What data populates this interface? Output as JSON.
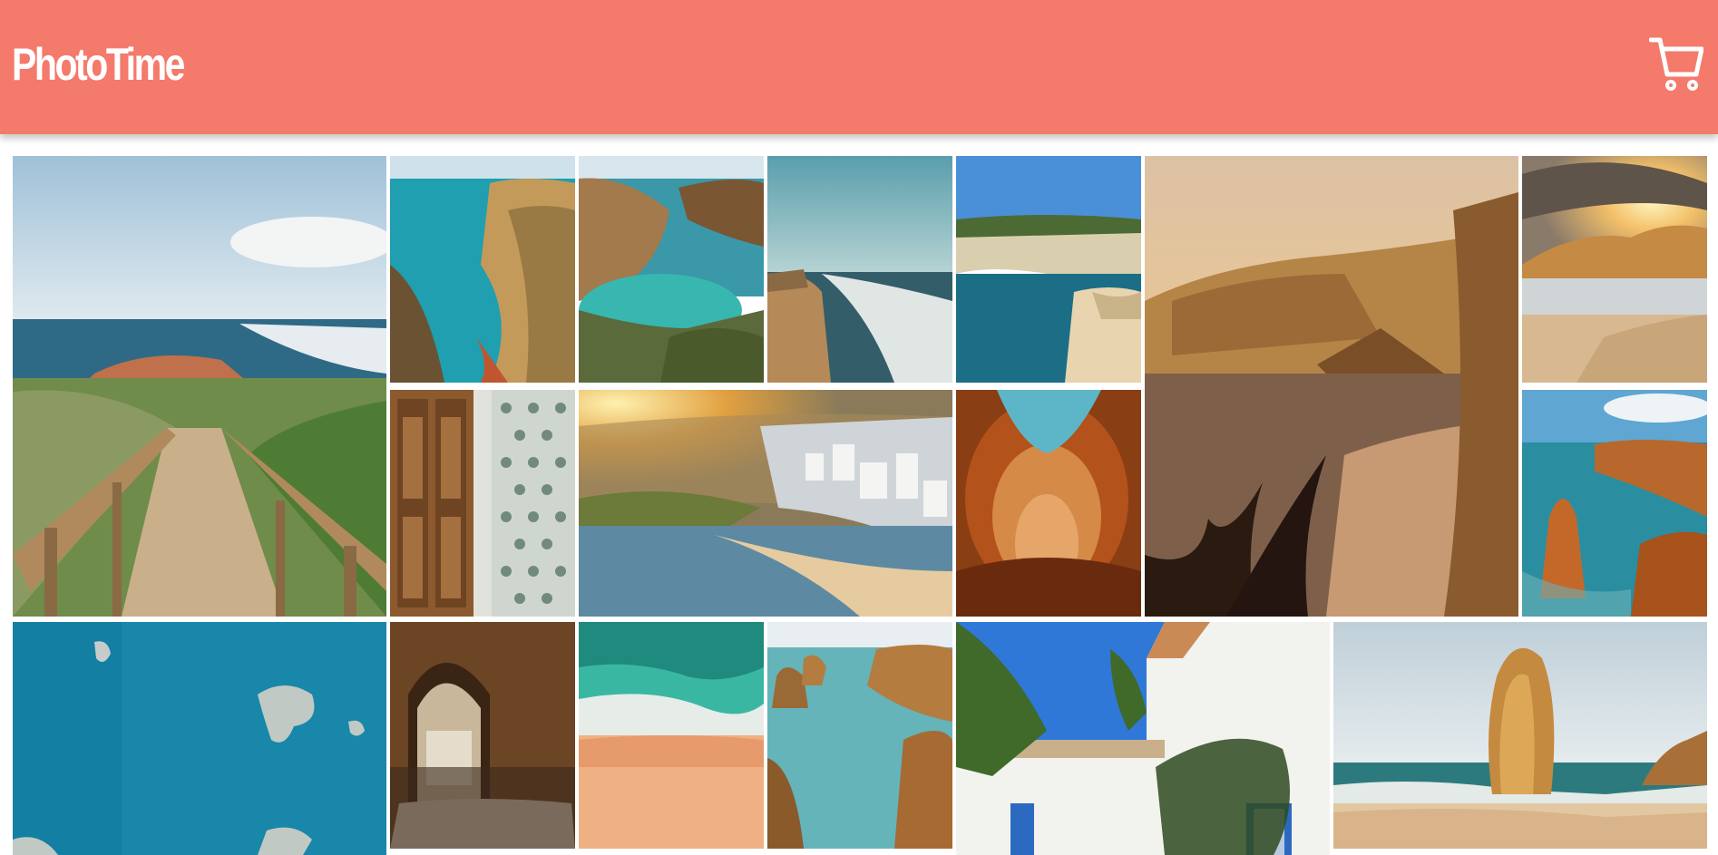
{
  "app": {
    "title": "PhotoTime"
  },
  "header": {
    "brand_color": "#f47a6c",
    "cart_icon": "cart-icon"
  },
  "gallery": {
    "photos": [
      {
        "name": "photo-boardwalk-coast"
      },
      {
        "name": "photo-turquoise-cove-cliffs"
      },
      {
        "name": "photo-rocky-lagoon"
      },
      {
        "name": "photo-beach-waves"
      },
      {
        "name": "photo-white-cliffs-beach"
      },
      {
        "name": "photo-sunset-cliffs-bay"
      },
      {
        "name": "photo-sunburst-rocks"
      },
      {
        "name": "photo-carved-wooden-door"
      },
      {
        "name": "photo-coastal-town-sunrise"
      },
      {
        "name": "photo-sea-cave-arch"
      },
      {
        "name": "photo-sea-stacks"
      },
      {
        "name": "photo-aerial-ocean-rocks"
      },
      {
        "name": "photo-stone-archway"
      },
      {
        "name": "photo-aerial-beach-shoreline"
      },
      {
        "name": "photo-cliffs-clear-water"
      },
      {
        "name": "photo-white-house-bougainvillea"
      },
      {
        "name": "photo-rock-pillar-beach"
      }
    ]
  }
}
